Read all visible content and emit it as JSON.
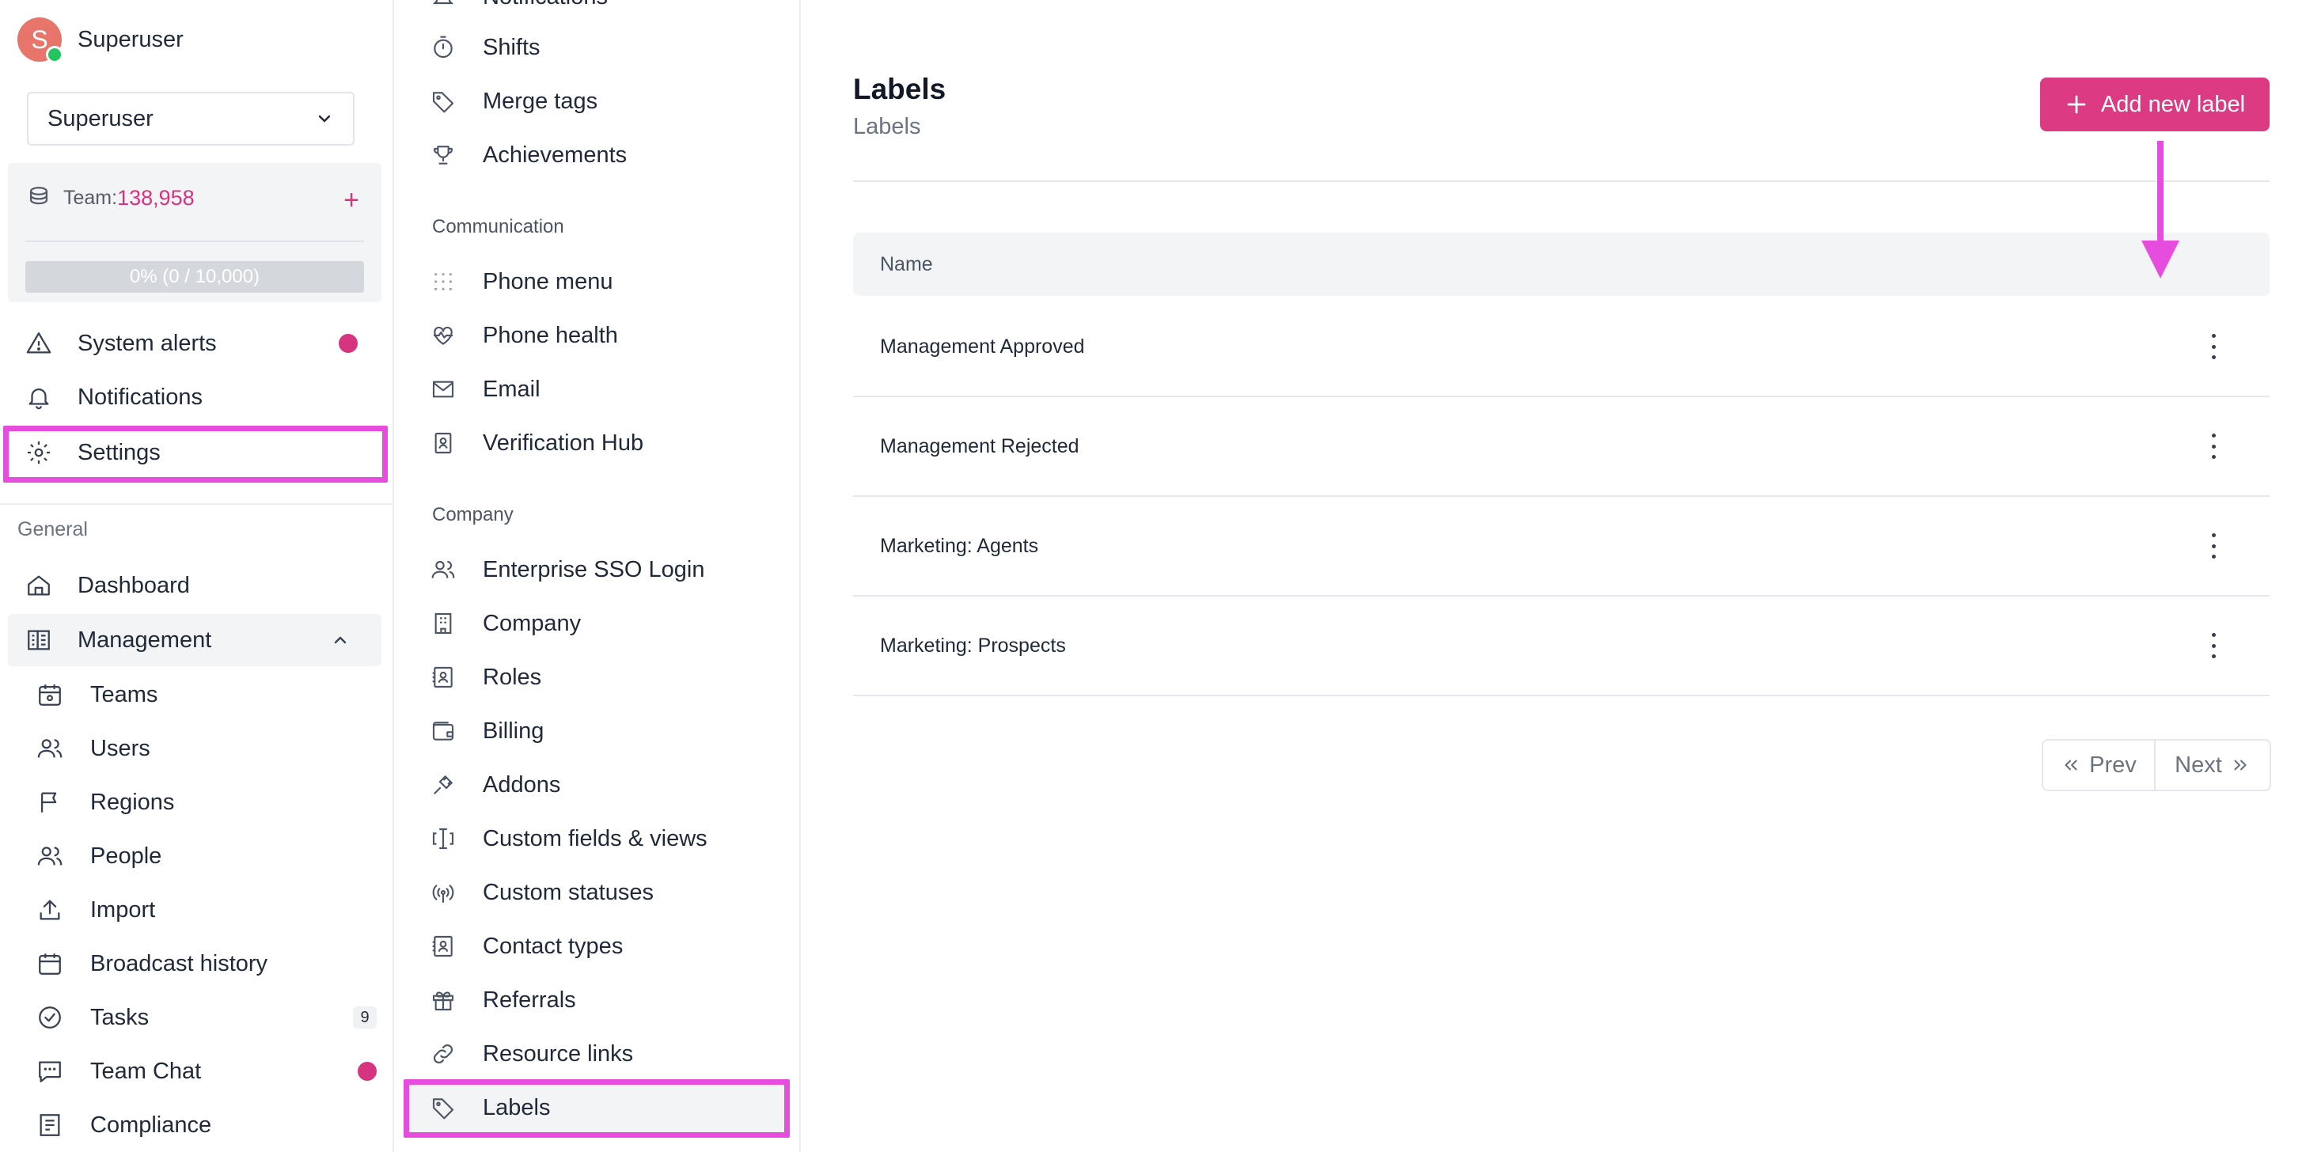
{
  "user": {
    "initial": "S",
    "name": "Superuser"
  },
  "user_select": {
    "value": "Superuser"
  },
  "team": {
    "label": "Team:",
    "count": "138,958",
    "progress_text": "0% (0 / 10,000)",
    "progress_fraction": 0.0
  },
  "sidebar_top": [
    {
      "label": "System alerts",
      "icon": "warning-icon",
      "has_dot": true
    },
    {
      "label": "Notifications",
      "icon": "bell-icon"
    },
    {
      "label": "Settings",
      "icon": "gear-icon"
    }
  ],
  "general": {
    "title": "General",
    "dashboard": "Dashboard",
    "management": "Management",
    "items": [
      {
        "label": "Teams",
        "icon": "calendar-team-icon"
      },
      {
        "label": "Users",
        "icon": "users-icon"
      },
      {
        "label": "Regions",
        "icon": "flag-icon"
      },
      {
        "label": "People",
        "icon": "people-icon"
      },
      {
        "label": "Import",
        "icon": "upload-icon"
      },
      {
        "label": "Broadcast history",
        "icon": "calendar-icon"
      },
      {
        "label": "Tasks",
        "icon": "check-circle-icon",
        "badge": "9"
      },
      {
        "label": "Team Chat",
        "icon": "chat-icon",
        "has_dot": true
      },
      {
        "label": "Compliance",
        "icon": "compliance-icon"
      }
    ]
  },
  "settings_menu": {
    "top_items": [
      {
        "label": "Notifications",
        "icon": "bell-icon"
      },
      {
        "label": "Shifts",
        "icon": "stopwatch-icon"
      },
      {
        "label": "Merge tags",
        "icon": "tag-icon"
      },
      {
        "label": "Achievements",
        "icon": "trophy-icon"
      }
    ],
    "communication_title": "Communication",
    "communication": [
      {
        "label": "Phone menu",
        "icon": "dots-grid-icon"
      },
      {
        "label": "Phone health",
        "icon": "heart-pulse-icon"
      },
      {
        "label": "Email",
        "icon": "mail-icon"
      },
      {
        "label": "Verification Hub",
        "icon": "id-badge-icon"
      }
    ],
    "company_title": "Company",
    "company": [
      {
        "label": "Enterprise SSO Login",
        "icon": "users-icon"
      },
      {
        "label": "Company",
        "icon": "building-icon"
      },
      {
        "label": "Roles",
        "icon": "contact-card-icon"
      },
      {
        "label": "Billing",
        "icon": "wallet-icon"
      },
      {
        "label": "Addons",
        "icon": "plug-icon"
      },
      {
        "label": "Custom fields & views",
        "icon": "text-cursor-icon"
      },
      {
        "label": "Custom statuses",
        "icon": "broadcast-icon"
      },
      {
        "label": "Contact types",
        "icon": "contact-card-icon"
      },
      {
        "label": "Referrals",
        "icon": "gift-icon"
      },
      {
        "label": "Resource links",
        "icon": "link-icon"
      },
      {
        "label": "Labels",
        "icon": "tag-icon"
      }
    ]
  },
  "main": {
    "title": "Labels",
    "subtitle": "Labels",
    "add_button": "Add new label",
    "table": {
      "column": "Name",
      "rows": [
        "Management Approved",
        "Management Rejected",
        "Marketing: Agents",
        "Marketing: Prospects"
      ]
    },
    "pager": {
      "prev": "Prev",
      "next": "Next"
    }
  },
  "colors": {
    "accent": "#dc3b83",
    "highlight": "#e64dde",
    "online": "#22c55e"
  }
}
